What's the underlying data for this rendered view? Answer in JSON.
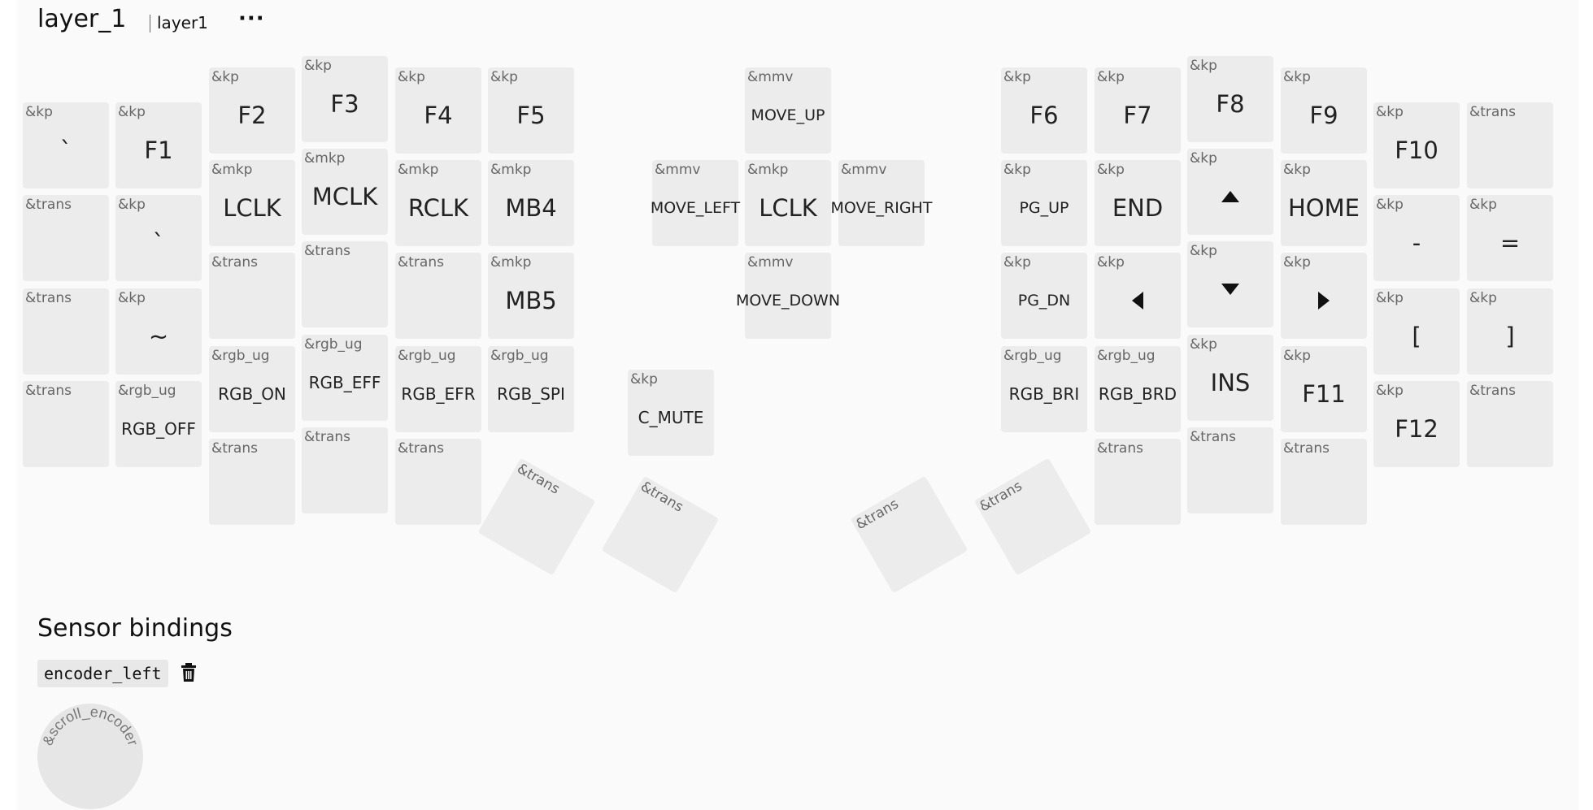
{
  "header": {
    "layer_title": "layer_1",
    "layer_name": "layer1",
    "menu": "···"
  },
  "keys": [
    {
      "b": "&kp",
      "l": "`"
    },
    {
      "b": "&kp",
      "l": "F1"
    },
    {
      "b": "&kp",
      "l": "F2"
    },
    {
      "b": "&kp",
      "l": "F3"
    },
    {
      "b": "&kp",
      "l": "F4"
    },
    {
      "b": "&kp",
      "l": "F5"
    },
    {
      "b": "&mmv",
      "l": "MOVE_UP"
    },
    {
      "b": "&kp",
      "l": "F6"
    },
    {
      "b": "&kp",
      "l": "F7"
    },
    {
      "b": "&kp",
      "l": "F8"
    },
    {
      "b": "&kp",
      "l": "F9"
    },
    {
      "b": "&kp",
      "l": "F10"
    },
    {
      "b": "&trans",
      "l": ""
    },
    {
      "b": "&trans",
      "l": ""
    },
    {
      "b": "&kp",
      "l": "`"
    },
    {
      "b": "&mkp",
      "l": "LCLK"
    },
    {
      "b": "&mkp",
      "l": "MCLK"
    },
    {
      "b": "&mkp",
      "l": "RCLK"
    },
    {
      "b": "&mkp",
      "l": "MB4"
    },
    {
      "b": "&mmv",
      "l": "MOVE_LEFT"
    },
    {
      "b": "&mkp",
      "l": "LCLK"
    },
    {
      "b": "&mmv",
      "l": "MOVE_RIGHT"
    },
    {
      "b": "&kp",
      "l": "PG_UP"
    },
    {
      "b": "&kp",
      "l": "END"
    },
    {
      "b": "&kp",
      "l": "▲",
      "icon": "up-arrow-icon"
    },
    {
      "b": "&kp",
      "l": "HOME"
    },
    {
      "b": "&kp",
      "l": "-"
    },
    {
      "b": "&kp",
      "l": "="
    },
    {
      "b": "&trans",
      "l": ""
    },
    {
      "b": "&kp",
      "l": "~"
    },
    {
      "b": "&trans",
      "l": ""
    },
    {
      "b": "&trans",
      "l": ""
    },
    {
      "b": "&trans",
      "l": ""
    },
    {
      "b": "&mkp",
      "l": "MB5"
    },
    {
      "b": "&mmv",
      "l": "MOVE_DOWN"
    },
    {
      "b": "&kp",
      "l": "PG_DN"
    },
    {
      "b": "&kp",
      "l": "◀",
      "icon": "left-arrow-icon"
    },
    {
      "b": "&kp",
      "l": "▼",
      "icon": "down-arrow-icon"
    },
    {
      "b": "&kp",
      "l": "▶",
      "icon": "right-arrow-icon"
    },
    {
      "b": "&kp",
      "l": "["
    },
    {
      "b": "&kp",
      "l": "]"
    },
    {
      "b": "&trans",
      "l": ""
    },
    {
      "b": "&rgb_ug",
      "l": "RGB_OFF"
    },
    {
      "b": "&rgb_ug",
      "l": "RGB_ON"
    },
    {
      "b": "&rgb_ug",
      "l": "RGB_EFF"
    },
    {
      "b": "&rgb_ug",
      "l": "RGB_EFR"
    },
    {
      "b": "&rgb_ug",
      "l": "RGB_SPI"
    },
    {
      "b": "&kp",
      "l": "C_MUTE"
    },
    {
      "b": "&rgb_ug",
      "l": "RGB_BRI"
    },
    {
      "b": "&rgb_ug",
      "l": "RGB_BRD"
    },
    {
      "b": "&kp",
      "l": "INS"
    },
    {
      "b": "&kp",
      "l": "F11"
    },
    {
      "b": "&kp",
      "l": "F12"
    },
    {
      "b": "&trans",
      "l": ""
    },
    {
      "b": "&trans",
      "l": ""
    },
    {
      "b": "&trans",
      "l": ""
    },
    {
      "b": "&trans",
      "l": ""
    },
    {
      "b": "&trans",
      "l": ""
    },
    {
      "b": "&trans",
      "l": ""
    },
    {
      "b": "&trans",
      "l": ""
    },
    {
      "b": "&trans",
      "l": ""
    },
    {
      "b": "&trans",
      "l": ""
    },
    {
      "b": "&trans",
      "l": ""
    },
    {
      "b": "&trans",
      "l": ""
    }
  ],
  "sensors": {
    "title": "Sensor bindings",
    "encoder_name": "encoder_left",
    "encoder_binding": "&scroll_encoder"
  },
  "colors": {
    "panel": "#fafafa",
    "key": "#ececec",
    "behavior_text": "#666666",
    "legend_text": "#222222"
  }
}
